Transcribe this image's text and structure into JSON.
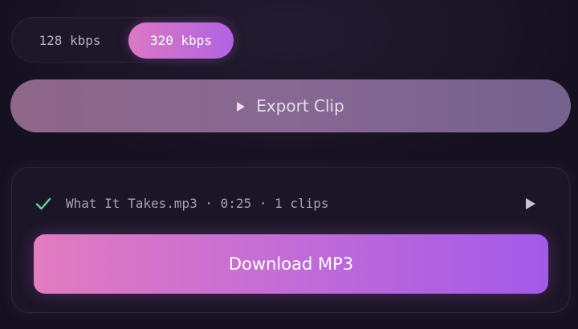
{
  "bitrate": {
    "options": [
      {
        "label": "128 kbps",
        "selected": false
      },
      {
        "label": "320 kbps",
        "selected": true
      }
    ]
  },
  "export": {
    "label": "Export Clip",
    "icon": "play-icon"
  },
  "result": {
    "status_icon": "check-icon",
    "file_name": "What It Takes.mp3",
    "duration": "0:25",
    "clips": "1 clips",
    "separator": " · ",
    "play_icon": "play-icon",
    "download_label": "Download MP3"
  },
  "colors": {
    "background": "#161120",
    "accent_start": "#e27cc0",
    "accent_end": "#a25ae8",
    "check": "#67d39a"
  }
}
